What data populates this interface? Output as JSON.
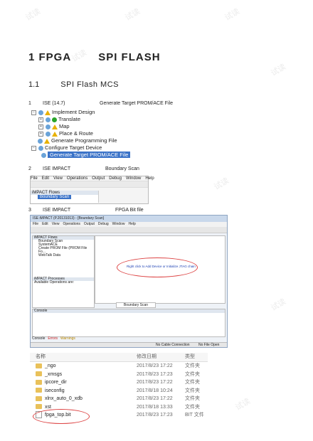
{
  "watermark": "试读",
  "heading": {
    "num": "1 FPGA",
    "title": "SPI FLASH"
  },
  "section": {
    "num": "1.1",
    "title": "SPI Flash MCS"
  },
  "steps": [
    {
      "num": "1",
      "a": "ISE (14.7)",
      "b": "Generate Target PROM/ACE File"
    },
    {
      "num": "2",
      "a": "ISE IMPACT",
      "b": "Boundary Scan"
    },
    {
      "num": "3",
      "a": "ISE IMPACT",
      "b": "FPGA Bit file"
    }
  ],
  "tree": {
    "items": [
      "Implement Design",
      "Translate",
      "Map",
      "Place & Route",
      "Generate Programming File",
      "Configure Target Device",
      "Generate Target PROM/ACE File"
    ]
  },
  "impact_small": {
    "menu": [
      "File",
      "Edit",
      "View",
      "Operations",
      "Output",
      "Debug",
      "Window",
      "Help"
    ],
    "pane_title": "iMPACT Flows",
    "selected": "Boundary Scan"
  },
  "impact_window": {
    "title": "ISE iMPACT (P.20131013) - [Boundary Scan]",
    "menu": [
      "File",
      "Edit",
      "View",
      "Operations",
      "Output",
      "Debug",
      "Window",
      "Help"
    ],
    "flows_title": "iMPACT Flows",
    "flows": [
      "Boundary Scan",
      "SystemACE",
      "Create PROM File (PROM File Fo...",
      "WebTalk Data"
    ],
    "processes_title": "iMPACT Processes",
    "processes_text": "Available Operations are:",
    "hint": "Right click to Add Device or Initialize JTAG chain",
    "tab": "Boundary Scan",
    "console_title": "Console",
    "console_tabs": [
      "Console",
      "Errors",
      "Warnings"
    ],
    "status": [
      "No Cable Connection",
      "No File Open"
    ]
  },
  "explorer": {
    "headers": [
      "名称",
      "修改日期",
      "类型"
    ],
    "rows": [
      {
        "name": "_ngo",
        "date": "2017/8/23 17:22",
        "type": "文件夹"
      },
      {
        "name": "_xmsgs",
        "date": "2017/8/23 17:23",
        "type": "文件夹"
      },
      {
        "name": "ipcore_dir",
        "date": "2017/8/23 17:22",
        "type": "文件夹"
      },
      {
        "name": "iseconfig",
        "date": "2017/8/18 10:24",
        "type": "文件夹"
      },
      {
        "name": "xlnx_auto_0_xdb",
        "date": "2017/8/23 17:22",
        "type": "文件夹"
      },
      {
        "name": "xst",
        "date": "2017/8/18 13:33",
        "type": "文件夹"
      },
      {
        "name": "fpga_top.bit",
        "date": "2017/8/23 17:23",
        "type": "BIT 文件"
      }
    ]
  }
}
